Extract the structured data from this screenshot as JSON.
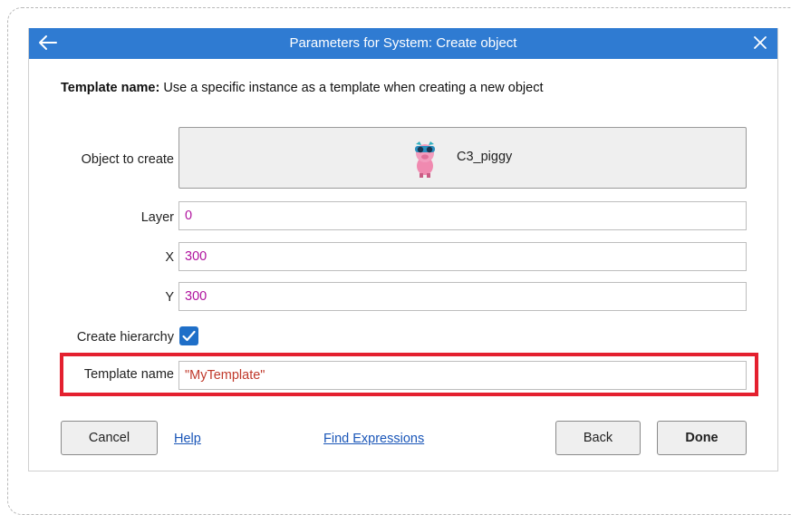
{
  "dialog": {
    "title": "Parameters for System: Create object",
    "back_icon": "arrow-left-icon",
    "close_icon": "close-icon",
    "accent_color": "#2f7bd2"
  },
  "description": {
    "term": "Template name:",
    "text": " Use a specific instance as a template when creating a new object"
  },
  "params": {
    "object_label": "Object to create",
    "object_value": "C3_piggy",
    "object_icon": "piggy-sprite-icon",
    "layer_label": "Layer",
    "layer_value": "0",
    "x_label": "X",
    "x_value": "300",
    "y_label": "Y",
    "y_value": "300",
    "hierarchy_label": "Create hierarchy",
    "hierarchy_checked": true,
    "template_label": "Template name",
    "template_value": "\"MyTemplate\""
  },
  "footer": {
    "cancel_label": "Cancel",
    "help_label": "Help",
    "find_expressions_label": "Find Expressions",
    "back_label": "Back",
    "done_label": "Done"
  },
  "highlight_color": "#e4202f",
  "value_color": "#b0139e"
}
